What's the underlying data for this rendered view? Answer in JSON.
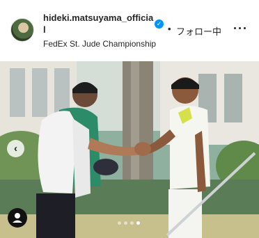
{
  "post": {
    "username": "hideki.matsuyama_official",
    "verified": true,
    "separator": "•",
    "follow_label": "フォロー中",
    "location": "FedEx St. Jude Championship"
  },
  "carousel": {
    "slide_count": 4,
    "active_slide": 4,
    "prev_icon": "chevron-left-icon",
    "tag_icon": "user-icon"
  },
  "colors": {
    "verified_badge": "#0095f6",
    "text": "#262626"
  }
}
